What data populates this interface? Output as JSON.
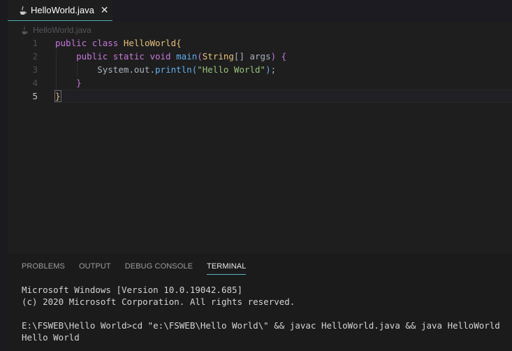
{
  "tab": {
    "label": "HelloWorld.java",
    "close_glyph": "✕",
    "icon": "java-icon"
  },
  "breadcrumb": {
    "label": "HelloWorld.java",
    "icon": "java-icon"
  },
  "editor": {
    "active_line": 5,
    "lines": [
      {
        "number": "1",
        "tokens": [
          {
            "text": "public ",
            "cls": "kw"
          },
          {
            "text": "class ",
            "cls": "kw"
          },
          {
            "text": "HelloWorld",
            "cls": "cls"
          },
          {
            "text": "{",
            "cls": "br-gold"
          }
        ]
      },
      {
        "number": "2",
        "tokens": [
          {
            "text": "    "
          },
          {
            "text": "public ",
            "cls": "kw"
          },
          {
            "text": "static ",
            "cls": "kw"
          },
          {
            "text": "void ",
            "cls": "kw"
          },
          {
            "text": "main",
            "cls": "fn"
          },
          {
            "text": "(",
            "cls": "br-purple"
          },
          {
            "text": "String",
            "cls": "cls"
          },
          {
            "text": "[] ",
            "cls": "txt"
          },
          {
            "text": "args",
            "cls": "txt"
          },
          {
            "text": ") ",
            "cls": "br-purple"
          },
          {
            "text": "{",
            "cls": "br-purple"
          }
        ]
      },
      {
        "number": "3",
        "tokens": [
          {
            "text": "        "
          },
          {
            "text": "System",
            "cls": "txt"
          },
          {
            "text": ".",
            "cls": "txt"
          },
          {
            "text": "out",
            "cls": "txt"
          },
          {
            "text": ".",
            "cls": "txt"
          },
          {
            "text": "println",
            "cls": "fn"
          },
          {
            "text": "(",
            "cls": "br-blue"
          },
          {
            "text": "\"Hello World\"",
            "cls": "str"
          },
          {
            "text": ")",
            "cls": "br-blue"
          },
          {
            "text": ";",
            "cls": "txt"
          }
        ]
      },
      {
        "number": "4",
        "tokens": [
          {
            "text": "    "
          },
          {
            "text": "}",
            "cls": "br-purple"
          }
        ]
      },
      {
        "number": "5",
        "tokens": [
          {
            "text": "}",
            "cls": "br-gold bracket-match"
          }
        ]
      }
    ]
  },
  "panel": {
    "tabs": [
      {
        "label": "PROBLEMS",
        "active": false
      },
      {
        "label": "OUTPUT",
        "active": false
      },
      {
        "label": "DEBUG CONSOLE",
        "active": false
      },
      {
        "label": "TERMINAL",
        "active": true
      }
    ],
    "terminal_lines": [
      "Microsoft Windows [Version 10.0.19042.685]",
      "(c) 2020 Microsoft Corporation. All rights reserved.",
      "",
      "E:\\FSWEB\\Hello World>cd \"e:\\FSWEB\\Hello World\\\" && javac HelloWorld.java && java HelloWorld",
      "Hello World"
    ]
  },
  "colors": {
    "background": "#1e1e1e",
    "keyword": "#c678dd",
    "class": "#e5c07b",
    "function": "#61afef",
    "string": "#98c379",
    "tab_underline": "#4fb0b0"
  }
}
